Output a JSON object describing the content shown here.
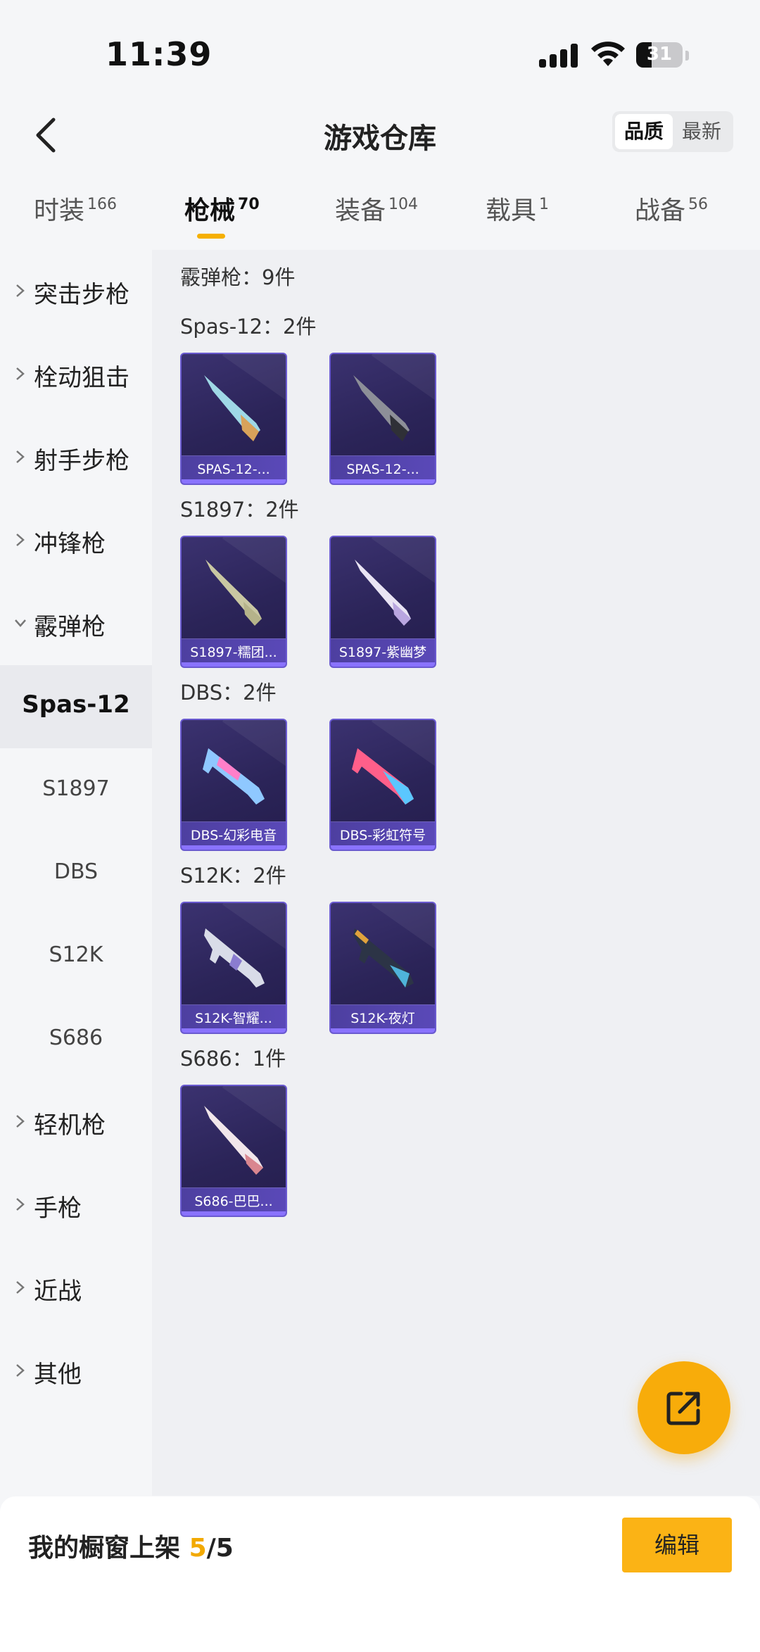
{
  "status_bar": {
    "time": "11:39",
    "battery": "31"
  },
  "header": {
    "title": "游戏仓库",
    "sort_options": [
      "品质",
      "最新"
    ]
  },
  "tabs": [
    {
      "label": "时装",
      "count": "166"
    },
    {
      "label": "枪械",
      "count": "70"
    },
    {
      "label": "装备",
      "count": "104"
    },
    {
      "label": "载具",
      "count": "1"
    },
    {
      "label": "战备",
      "count": "56"
    }
  ],
  "sidebar": {
    "categories": [
      "突击步枪",
      "栓动狙击",
      "射手步枪",
      "冲锋枪",
      "霰弹枪"
    ],
    "subitems": [
      "Spas-12",
      "S1897",
      "DBS",
      "S12K",
      "S686"
    ],
    "more_categories": [
      "轻机枪",
      "手枪",
      "近战",
      "其他"
    ]
  },
  "main": {
    "section_title": "霰弹枪：9件",
    "groups": [
      {
        "title": "Spas-12：2件",
        "items": [
          "SPAS-12-...",
          "SPAS-12-..."
        ]
      },
      {
        "title": "S1897：2件",
        "items": [
          "S1897-糯团...",
          "S1897-紫幽梦"
        ]
      },
      {
        "title": "DBS：2件",
        "items": [
          "DBS-幻彩电音",
          "DBS-彩虹符号"
        ]
      },
      {
        "title": "S12K：2件",
        "items": [
          "S12K-智耀...",
          "S12K-夜灯"
        ]
      },
      {
        "title": "S686：1件",
        "items": [
          "S686-巴巴..."
        ]
      }
    ]
  },
  "bottom": {
    "showcase_label": "我的橱窗上架",
    "showcase_current": "5",
    "showcase_total": "/5",
    "edit_label": "编辑"
  },
  "icons": {
    "fab": "share-external-icon",
    "back": "chevron-left-icon"
  },
  "colors": {
    "accent": "#f5b000",
    "card_bg": "#2b2458",
    "card_border": "#6a5ad0"
  }
}
